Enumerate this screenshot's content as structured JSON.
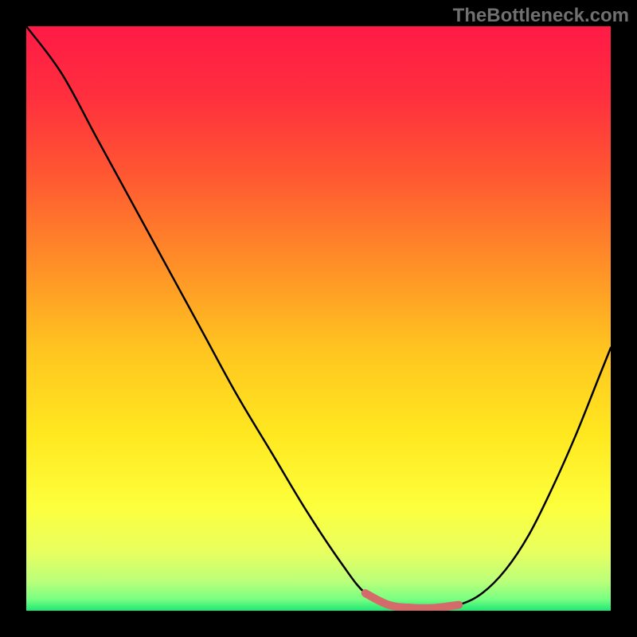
{
  "watermark": "TheBottleneck.com",
  "chart_data": {
    "type": "line",
    "title": "",
    "xlabel": "",
    "ylabel": "",
    "xlim": [
      0,
      100
    ],
    "ylim": [
      0,
      100
    ],
    "series": [
      {
        "name": "curve",
        "x": [
          0,
          6,
          12,
          18,
          24,
          30,
          36,
          42,
          48,
          54,
          58,
          62,
          66,
          70,
          74,
          78,
          82,
          86,
          90,
          94,
          98,
          100
        ],
        "y": [
          100,
          92,
          81,
          70,
          59,
          48,
          37,
          27,
          17,
          8,
          3,
          1,
          0.5,
          0.5,
          1,
          3,
          7,
          13,
          21,
          30,
          40,
          45
        ]
      }
    ],
    "highlight_band": {
      "x_start": 56,
      "x_end": 74
    },
    "gradient_stops": [
      {
        "offset": 0.0,
        "color": "#ff1a46"
      },
      {
        "offset": 0.12,
        "color": "#ff2f3e"
      },
      {
        "offset": 0.25,
        "color": "#ff5632"
      },
      {
        "offset": 0.4,
        "color": "#ff8c28"
      },
      {
        "offset": 0.55,
        "color": "#ffc420"
      },
      {
        "offset": 0.7,
        "color": "#ffe820"
      },
      {
        "offset": 0.82,
        "color": "#fdff3c"
      },
      {
        "offset": 0.9,
        "color": "#e8ff60"
      },
      {
        "offset": 0.95,
        "color": "#baff7a"
      },
      {
        "offset": 0.98,
        "color": "#7aff82"
      },
      {
        "offset": 1.0,
        "color": "#20e874"
      }
    ]
  }
}
